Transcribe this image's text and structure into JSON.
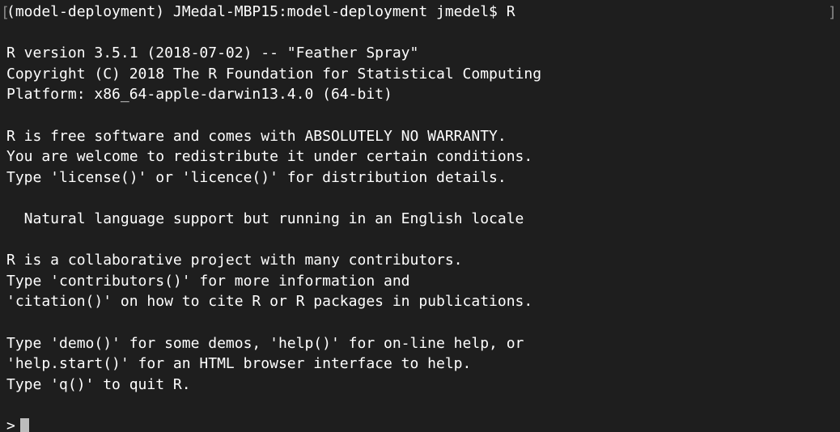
{
  "terminal": {
    "shell_prompt": "(model-deployment) JMedal-MBP15:model-deployment jmedel$ R",
    "lines": [
      "R version 3.5.1 (2018-07-02) -- \"Feather Spray\"",
      "Copyright (C) 2018 The R Foundation for Statistical Computing",
      "Platform: x86_64-apple-darwin13.4.0 (64-bit)",
      "",
      "R is free software and comes with ABSOLUTELY NO WARRANTY.",
      "You are welcome to redistribute it under certain conditions.",
      "Type 'license()' or 'licence()' for distribution details.",
      "",
      "  Natural language support but running in an English locale",
      "",
      "R is a collaborative project with many contributors.",
      "Type 'contributors()' for more information and",
      "'citation()' on how to cite R or R packages in publications.",
      "",
      "Type 'demo()' for some demos, 'help()' for on-line help, or",
      "'help.start()' for an HTML browser interface to help.",
      "Type 'q()' to quit R."
    ],
    "r_prompt": ">",
    "left_bracket": "[",
    "right_bracket": "]"
  }
}
